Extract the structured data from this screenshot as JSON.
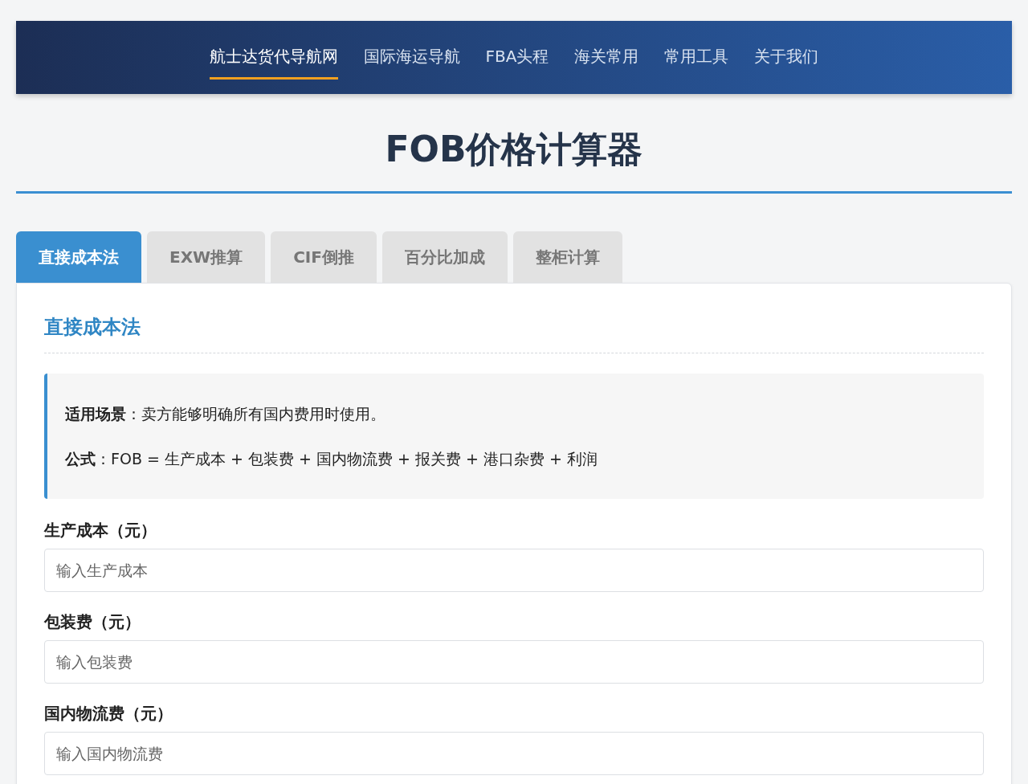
{
  "nav": {
    "items": [
      {
        "label": "航士达货代导航网",
        "selected": true
      },
      {
        "label": "国际海运导航",
        "selected": false
      },
      {
        "label": "FBA头程",
        "selected": false
      },
      {
        "label": "海关常用",
        "selected": false
      },
      {
        "label": "常用工具",
        "selected": false
      },
      {
        "label": "关于我们",
        "selected": false
      }
    ]
  },
  "title": "FOB价格计算器",
  "tabs": [
    {
      "label": "直接成本法",
      "selected": true
    },
    {
      "label": "EXW推算",
      "selected": false
    },
    {
      "label": "CIF倒推",
      "selected": false
    },
    {
      "label": "百分比加成",
      "selected": false
    },
    {
      "label": "整柜计算",
      "selected": false
    }
  ],
  "panel": {
    "heading": "直接成本法",
    "info": [
      "**适用场景**：卖方能够明确所有国内费用时使用。",
      "**公式**：FOB = 生产成本 + 包装费 + 国内物流费 + 报关费 + 港口杂费 + 利润"
    ],
    "fields": [
      {
        "label": "生产成本（元）",
        "placeholder": "输入生产成本"
      },
      {
        "label": "包装费（元）",
        "placeholder": "输入包装费"
      },
      {
        "label": "国内物流费（元）",
        "placeholder": "输入国内物流费"
      }
    ]
  }
}
